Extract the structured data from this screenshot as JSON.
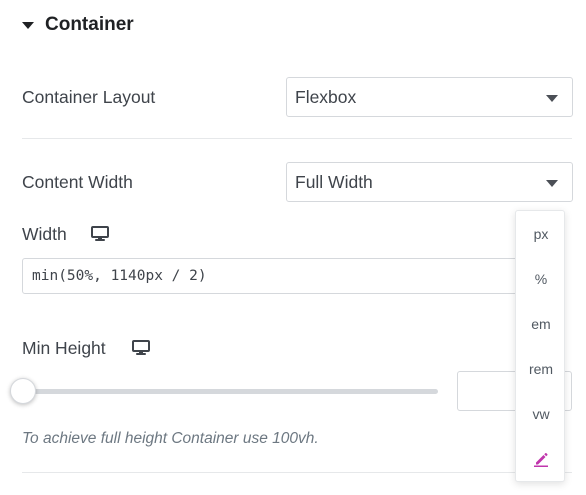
{
  "section": {
    "title": "Container"
  },
  "container_layout": {
    "label": "Container Layout",
    "value": "Flexbox"
  },
  "content_width": {
    "label": "Content Width",
    "value": "Full Width"
  },
  "width": {
    "label": "Width",
    "value": "min(50%, 1140px / 2)"
  },
  "min_height": {
    "label": "Min Height",
    "slider_value": 0,
    "value": ""
  },
  "hint": "To achieve full height Container use 100vh.",
  "units": [
    "px",
    "%",
    "em",
    "rem",
    "vw"
  ],
  "colors": {
    "accent": "#c036ac"
  },
  "icons": {
    "responsive": "monitor-icon",
    "custom_unit": "pencil-icon"
  }
}
